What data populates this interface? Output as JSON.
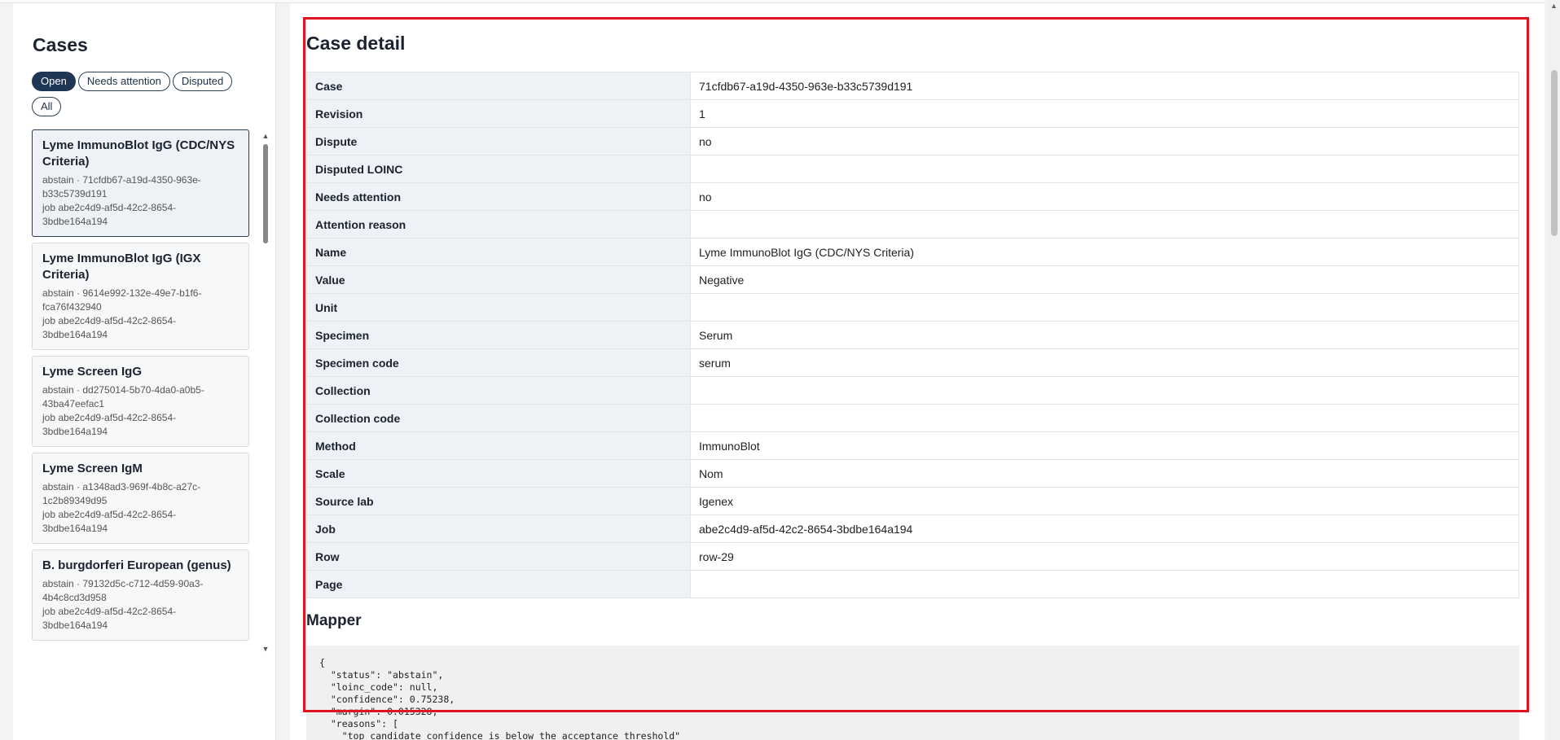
{
  "sidebar": {
    "title": "Cases",
    "filters": [
      {
        "label": "Open",
        "active": true
      },
      {
        "label": "Needs attention",
        "active": false
      },
      {
        "label": "Disputed",
        "active": false
      },
      {
        "label": "All",
        "active": false
      }
    ],
    "cases": [
      {
        "title": "Lyme ImmunoBlot IgG (CDC/NYS Criteria)",
        "meta1": "abstain · 71cfdb67-a19d-4350-963e-b33c5739d191",
        "meta2": "job abe2c4d9-af5d-42c2-8654-3bdbe164a194",
        "selected": true
      },
      {
        "title": "Lyme ImmunoBlot IgG (IGX Criteria)",
        "meta1": "abstain · 9614e992-132e-49e7-b1f6-fca76f432940",
        "meta2": "job abe2c4d9-af5d-42c2-8654-3bdbe164a194",
        "selected": false
      },
      {
        "title": "Lyme Screen IgG",
        "meta1": "abstain · dd275014-5b70-4da0-a0b5-43ba47eefac1",
        "meta2": "job abe2c4d9-af5d-42c2-8654-3bdbe164a194",
        "selected": false
      },
      {
        "title": "Lyme Screen IgM",
        "meta1": "abstain · a1348ad3-969f-4b8c-a27c-1c2b89349d95",
        "meta2": "job abe2c4d9-af5d-42c2-8654-3bdbe164a194",
        "selected": false
      },
      {
        "title": "B. burgdorferi European (genus)",
        "meta1": "abstain · 79132d5c-c712-4d59-90a3-4b4c8cd3d958",
        "meta2": "job abe2c4d9-af5d-42c2-8654-3bdbe164a194",
        "selected": false
      }
    ],
    "scroll_up_icon": "▲",
    "scroll_down_icon": "▼"
  },
  "detail": {
    "title": "Case detail",
    "rows": [
      {
        "key": "Case",
        "value": "71cfdb67-a19d-4350-963e-b33c5739d191"
      },
      {
        "key": "Revision",
        "value": "1"
      },
      {
        "key": "Dispute",
        "value": "no"
      },
      {
        "key": "Disputed LOINC",
        "value": ""
      },
      {
        "key": "Needs attention",
        "value": "no"
      },
      {
        "key": "Attention reason",
        "value": ""
      },
      {
        "key": "Name",
        "value": "Lyme ImmunoBlot IgG (CDC/NYS Criteria)"
      },
      {
        "key": "Value",
        "value": "Negative"
      },
      {
        "key": "Unit",
        "value": ""
      },
      {
        "key": "Specimen",
        "value": "Serum"
      },
      {
        "key": "Specimen code",
        "value": "serum"
      },
      {
        "key": "Collection",
        "value": ""
      },
      {
        "key": "Collection code",
        "value": ""
      },
      {
        "key": "Method",
        "value": "ImmunoBlot"
      },
      {
        "key": "Scale",
        "value": "Nom"
      },
      {
        "key": "Source lab",
        "value": "Igenex"
      },
      {
        "key": "Job",
        "value": "abe2c4d9-af5d-42c2-8654-3bdbe164a194"
      },
      {
        "key": "Row",
        "value": "row-29"
      },
      {
        "key": "Page",
        "value": ""
      }
    ]
  },
  "mapper": {
    "title": "Mapper",
    "json_text": "{\n  \"status\": \"abstain\",\n  \"loinc_code\": null,\n  \"confidence\": 0.75238,\n  \"margin\": 0.015328,\n  \"reasons\": [\n    \"top candidate confidence is below the acceptance threshold\""
  },
  "colors": {
    "accent": "#1f3654",
    "highlight": "#e0141e"
  }
}
